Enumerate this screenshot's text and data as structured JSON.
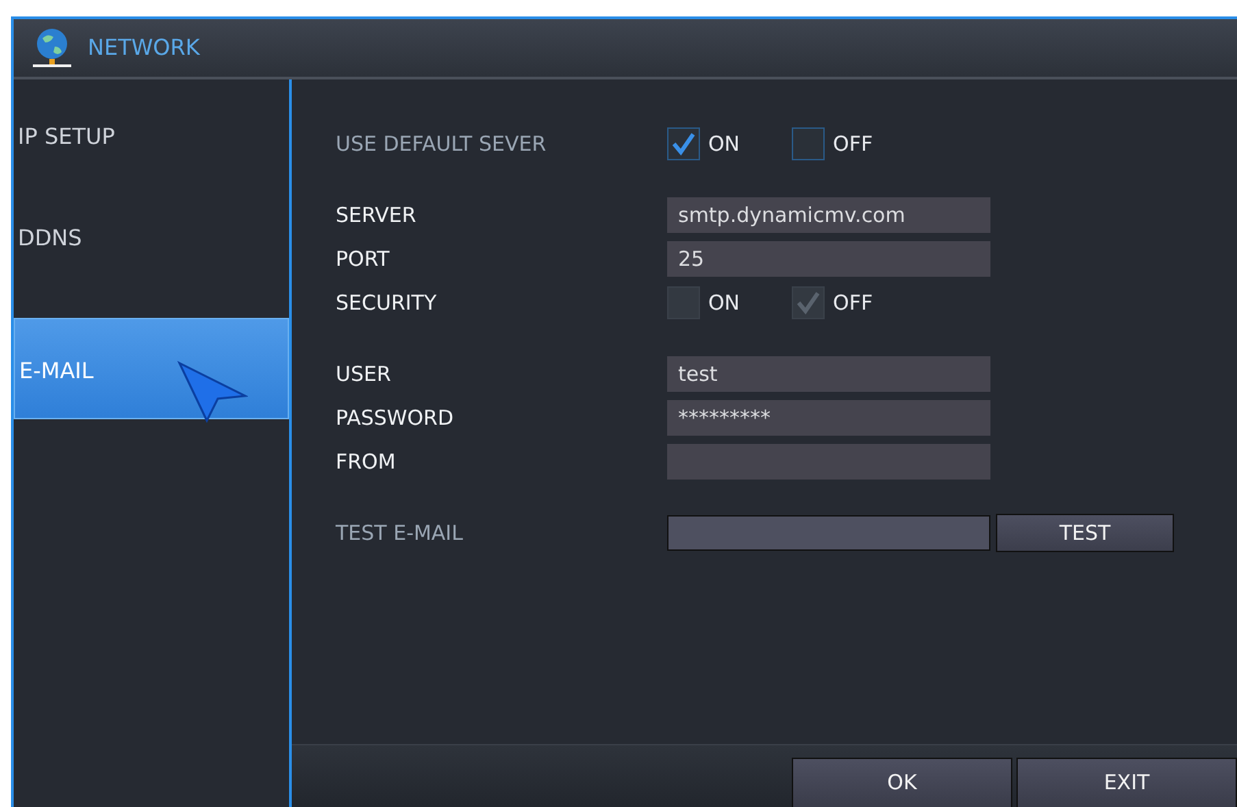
{
  "window": {
    "title": "NETWORK"
  },
  "sidebar": {
    "items": [
      {
        "label": "IP SETUP",
        "selected": false
      },
      {
        "label": "DDNS",
        "selected": false
      },
      {
        "label": "E-MAIL",
        "selected": true
      }
    ]
  },
  "groups": [
    [
      {
        "kind": "choice",
        "label": "USE DEFAULT SEVER",
        "disabled": true,
        "options": [
          {
            "label": "ON",
            "checked": true,
            "disabled": false
          },
          {
            "label": "OFF",
            "checked": false,
            "disabled": false
          }
        ]
      }
    ],
    [
      {
        "kind": "field",
        "label": "SERVER",
        "disabled": false,
        "value": "smtp.dynamicmv.com"
      },
      {
        "kind": "field",
        "label": "PORT",
        "disabled": false,
        "value": "25"
      },
      {
        "kind": "choice",
        "label": "SECURITY",
        "disabled": false,
        "options": [
          {
            "label": "ON",
            "checked": false,
            "disabled": true
          },
          {
            "label": "OFF",
            "checked": true,
            "disabled": true
          }
        ]
      }
    ],
    [
      {
        "kind": "field",
        "label": "USER",
        "disabled": false,
        "value": "test"
      },
      {
        "kind": "field",
        "label": "PASSWORD",
        "disabled": false,
        "value": "*********"
      },
      {
        "kind": "field",
        "label": "FROM",
        "disabled": false
      }
    ],
    [
      {
        "kind": "test",
        "label": "TEST E-MAIL",
        "disabled": true,
        "button": "TEST"
      }
    ]
  ],
  "buttons": [
    "OK",
    "EXIT"
  ]
}
